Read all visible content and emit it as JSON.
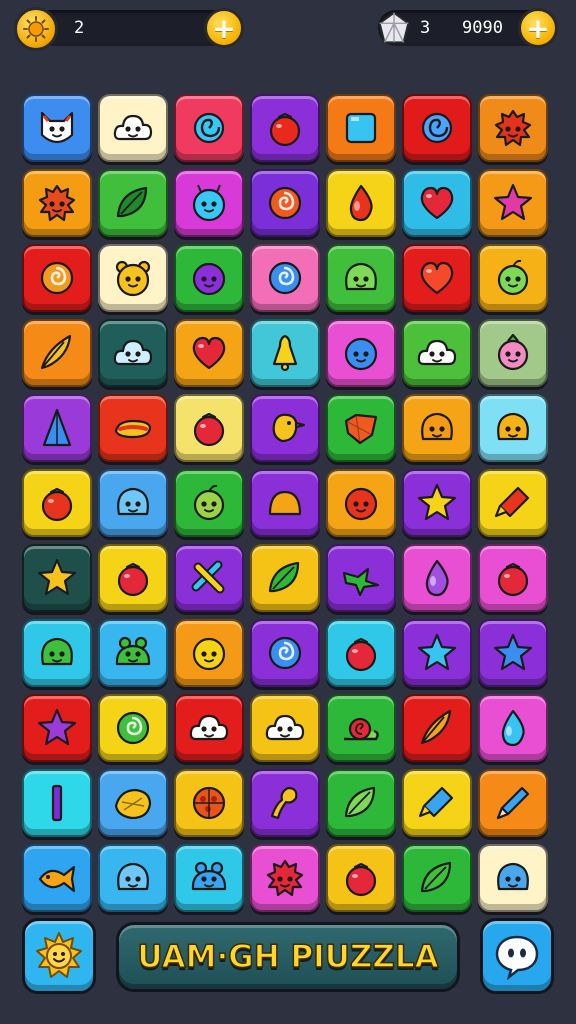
{
  "hud": {
    "left_value": "2",
    "right_count": "3",
    "right_value": "9090"
  },
  "title": "UAM·GH PIUZZLA",
  "colors": {
    "background": "#2e3140",
    "accent_gold": "#f4b000",
    "title_bar": "#2f6a70"
  },
  "board": {
    "rows": [
      [
        {
          "bg": "#3d8df0",
          "icon": "fox-face-icon",
          "fg": "#ffffff"
        },
        {
          "bg": "#fff3c8",
          "icon": "cloud-face-icon",
          "fg": "#ffffff"
        },
        {
          "bg": "#f03a5f",
          "icon": "swirl-icon",
          "fg": "#39c6f5"
        },
        {
          "bg": "#8b2fd8",
          "icon": "tomato-icon",
          "fg": "#e8291c"
        },
        {
          "bg": "#f47a16",
          "icon": "square-icon",
          "fg": "#38c4f2"
        },
        {
          "bg": "#e11a1a",
          "icon": "swirl-icon",
          "fg": "#4aa3ff"
        },
        {
          "bg": "#f08a18",
          "icon": "spiky-ball-icon",
          "fg": "#e4321c"
        }
      ],
      [
        {
          "bg": "#f59d12",
          "icon": "spiky-ball-icon",
          "fg": "#e64a1e"
        },
        {
          "bg": "#3fbf3b",
          "icon": "leaf-icon",
          "fg": "#1f8a2a"
        },
        {
          "bg": "#d83ad8",
          "icon": "bug-face-icon",
          "fg": "#38c8f5"
        },
        {
          "bg": "#7a2fd8",
          "icon": "spiral-icon",
          "fg": "#f05a1e"
        },
        {
          "bg": "#f5d316",
          "icon": "drop-icon",
          "fg": "#e8341c"
        },
        {
          "bg": "#2fbde8",
          "icon": "heart-icon",
          "fg": "#e4283a"
        },
        {
          "bg": "#f59a16",
          "icon": "star-icon",
          "fg": "#e03aa8"
        }
      ],
      [
        {
          "bg": "#e31c1c",
          "icon": "spiral-icon",
          "fg": "#f39a1e"
        },
        {
          "bg": "#fff3c8",
          "icon": "bear-face-icon",
          "fg": "#f5c21e"
        },
        {
          "bg": "#2eb83a",
          "icon": "ball-face-icon",
          "fg": "#8b2fd8"
        },
        {
          "bg": "#f26fb8",
          "icon": "spiral-icon",
          "fg": "#3a8ef0"
        },
        {
          "bg": "#3fbf3b",
          "icon": "blob-face-icon",
          "fg": "#7ed957"
        },
        {
          "bg": "#e31c1c",
          "icon": "heart-icon",
          "fg": "#f44a2a"
        },
        {
          "bg": "#f5b116",
          "icon": "apple-face-icon",
          "fg": "#7ed957"
        }
      ],
      [
        {
          "bg": "#f58a16",
          "icon": "feather-icon",
          "fg": "#f5c21e"
        },
        {
          "bg": "#1f5e5a",
          "icon": "cloud-face-icon",
          "fg": "#cfefff"
        },
        {
          "bg": "#f5a416",
          "icon": "heart-icon",
          "fg": "#e4283a"
        },
        {
          "bg": "#41c7d8",
          "icon": "bell-icon",
          "fg": "#f5d21e"
        },
        {
          "bg": "#e84fd2",
          "icon": "ball-face-icon",
          "fg": "#3a8ef0"
        },
        {
          "bg": "#4cbf3b",
          "icon": "cloud-face-icon",
          "fg": "#ffffff"
        },
        {
          "bg": "#a2c98a",
          "icon": "radish-face-icon",
          "fg": "#f28ac4"
        }
      ],
      [
        {
          "bg": "#9a3ad8",
          "icon": "triangle-icon",
          "fg": "#3a8ef0"
        },
        {
          "bg": "#e8341c",
          "icon": "hotdog-icon",
          "fg": "#f5c21e"
        },
        {
          "bg": "#f5e26a",
          "icon": "tomato-icon",
          "fg": "#e4283a"
        },
        {
          "bg": "#8b2fd8",
          "icon": "bird-icon",
          "fg": "#f5c21e"
        },
        {
          "bg": "#2eb83a",
          "icon": "gem-icon",
          "fg": "#f05a1e"
        },
        {
          "bg": "#f5a416",
          "icon": "blob-face-icon",
          "fg": "#f59a16"
        },
        {
          "bg": "#7fe0f5",
          "icon": "blob-face-icon",
          "fg": "#f5b116"
        }
      ],
      [
        {
          "bg": "#f5d316",
          "icon": "tomato-icon",
          "fg": "#e8341c"
        },
        {
          "bg": "#49a7f0",
          "icon": "blob-face-icon",
          "fg": "#6fc7f5"
        },
        {
          "bg": "#2eb83a",
          "icon": "apple-face-icon",
          "fg": "#9bd24a"
        },
        {
          "bg": "#8b2fd8",
          "icon": "dome-icon",
          "fg": "#f5a416"
        },
        {
          "bg": "#f5a416",
          "icon": "ball-face-icon",
          "fg": "#e8341c"
        },
        {
          "bg": "#8b2fd8",
          "icon": "star-icon",
          "fg": "#f5d316"
        },
        {
          "bg": "#f5d316",
          "icon": "rocket-icon",
          "fg": "#e8341c"
        }
      ],
      [
        {
          "bg": "#1f4f4a",
          "icon": "star-icon",
          "fg": "#f5c21e"
        },
        {
          "bg": "#f5d316",
          "icon": "tomato-icon",
          "fg": "#e4283a"
        },
        {
          "bg": "#8b2fd8",
          "icon": "cross-icon",
          "fg": "#38c4f2"
        },
        {
          "bg": "#f5c216",
          "icon": "leaf-icon",
          "fg": "#2eb83a"
        },
        {
          "bg": "#8b2fd8",
          "icon": "splash-icon",
          "fg": "#2eb83a"
        },
        {
          "bg": "#e84fd2",
          "icon": "drop-icon",
          "fg": "#a14fe0"
        },
        {
          "bg": "#e84fd2",
          "icon": "tomato-icon",
          "fg": "#e4283a"
        }
      ],
      [
        {
          "bg": "#2fc8e8",
          "icon": "blob-face-icon",
          "fg": "#3fbf3b"
        },
        {
          "bg": "#38b6f0",
          "icon": "frog-face-icon",
          "fg": "#3fbf3b"
        },
        {
          "bg": "#f59a16",
          "icon": "ball-face-icon",
          "fg": "#f5d316"
        },
        {
          "bg": "#8b2fd8",
          "icon": "spiral-icon",
          "fg": "#3a8ef0"
        },
        {
          "bg": "#2fc8e8",
          "icon": "tomato-icon",
          "fg": "#e4283a"
        },
        {
          "bg": "#8b2fd8",
          "icon": "star-icon",
          "fg": "#38c4f2"
        },
        {
          "bg": "#8b2fd8",
          "icon": "star-icon",
          "fg": "#3a8ef0"
        }
      ],
      [
        {
          "bg": "#e31c1c",
          "icon": "star-icon",
          "fg": "#9a3ad8"
        },
        {
          "bg": "#f5d316",
          "icon": "spiral-icon",
          "fg": "#3fbf3b"
        },
        {
          "bg": "#e31c1c",
          "icon": "cloud-face-icon",
          "fg": "#ffffff"
        },
        {
          "bg": "#f5c216",
          "icon": "cloud-face-icon",
          "fg": "#ffffff"
        },
        {
          "bg": "#2eb83a",
          "icon": "snail-icon",
          "fg": "#e4283a"
        },
        {
          "bg": "#e31c1c",
          "icon": "feather-icon",
          "fg": "#f5a416"
        },
        {
          "bg": "#e84fd2",
          "icon": "drop-icon",
          "fg": "#38c4f2"
        }
      ],
      [
        {
          "bg": "#2fd8e8",
          "icon": "bar-icon",
          "fg": "#7a2fd8"
        },
        {
          "bg": "#49a7f0",
          "icon": "lemon-icon",
          "fg": "#f5c21e"
        },
        {
          "bg": "#f5c216",
          "icon": "pizza-icon",
          "fg": "#e8541c"
        },
        {
          "bg": "#8b2fd8",
          "icon": "horn-icon",
          "fg": "#f5c21e"
        },
        {
          "bg": "#2eb83a",
          "icon": "leaf-icon",
          "fg": "#7ed957"
        },
        {
          "bg": "#f5d316",
          "icon": "rocket-icon",
          "fg": "#38a4f2"
        },
        {
          "bg": "#f58a16",
          "icon": "pencil-icon",
          "fg": "#38a4f2"
        }
      ],
      [
        {
          "bg": "#2fa4f0",
          "icon": "fish-icon",
          "fg": "#f5a416"
        },
        {
          "bg": "#38b6f0",
          "icon": "blob-face-icon",
          "fg": "#6fc7f5"
        },
        {
          "bg": "#2fc8e8",
          "icon": "frog-face-icon",
          "fg": "#38a4f2"
        },
        {
          "bg": "#e84fd2",
          "icon": "spiky-ball-icon",
          "fg": "#e4283a"
        },
        {
          "bg": "#f5c216",
          "icon": "tomato-icon",
          "fg": "#e4283a"
        },
        {
          "bg": "#2eb83a",
          "icon": "leaf-icon",
          "fg": "#3fbf3b"
        },
        {
          "bg": "#fff3c8",
          "icon": "blob-face-icon",
          "fg": "#49a7f0"
        }
      ]
    ]
  },
  "bottom": {
    "left_icon": "sun-face-icon",
    "right_icon": "chat-bubble-icon"
  }
}
